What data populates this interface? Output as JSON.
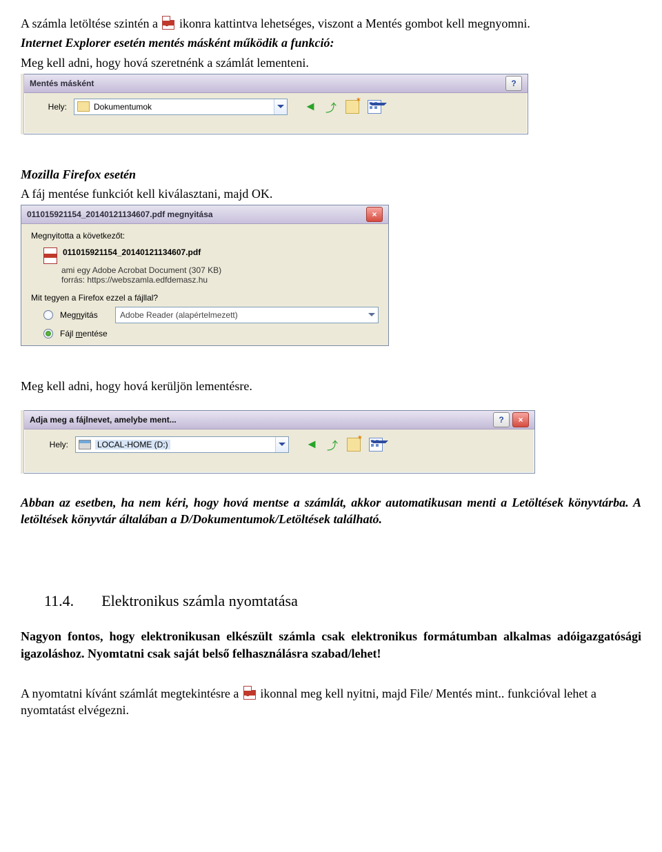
{
  "para1_a": "A számla letöltése szintén a ",
  "para1_b": "ikonra kattintva lehetséges, viszont a Mentés gombot kell megnyomni.",
  "para2_heading": "Internet Explorer esetén mentés másként működik a funkció:",
  "para2_line": "Meg kell adni, hogy hová szeretnénk a számlát lementeni.",
  "saveas1": {
    "title": "Mentés másként",
    "location_label": "Hely:",
    "location_value": "Dokumentumok"
  },
  "firefox_heading": "Mozilla Firefox esetén",
  "firefox_line": "A fáj mentése funkciót kell kiválasztani, majd OK.",
  "ff": {
    "title_suffix": "megnyitása",
    "filename": "011015921154_20140121134607.pdf",
    "opened_label": "Megnyitotta a következőt:",
    "meta_type": "ami egy  Adobe Acrobat Document (307 KB)",
    "meta_source": "forrás:  https://webszamla.edfdemasz.hu",
    "question": "Mit tegyen a Firefox ezzel a fájllal?",
    "opt_open_label": "Megnyitás",
    "opt_open_value": "Adobe Reader  (alapértelmezett)",
    "opt_save_label": "Fájl mentése"
  },
  "after_ff_line": "Meg kell adni, hogy hová kerüljön lementésre.",
  "saveas2": {
    "title": "Adja meg a fájlnevet, amelybe ment...",
    "location_label": "Hely:",
    "location_value": "LOCAL-HOME (D:)"
  },
  "auto_save_note": "Abban az esetben, ha nem kéri, hogy hová mentse a számlát, akkor automatikusan menti a Letöltések könyvtárba. A letöltések könyvtár általában a D/Dokumentumok/Letöltések található.",
  "section_number": "11.4.",
  "section_title": "Elektronikus számla nyomtatása",
  "important_note": "Nagyon fontos, hogy elektronikusan elkészült számla csak elektronikus formátumban alkalmas adóigazgatósági igazoláshoz. Nyomtatni csak saját belső felhasználásra szabad/lehet!",
  "print_para_a": "A nyomtatni kívánt számlát megtekintésre a ",
  "print_para_b": "ikonnal meg kell nyitni, majd File/ Mentés mint.. funkcióval lehet a nyomtatást elvégezni."
}
